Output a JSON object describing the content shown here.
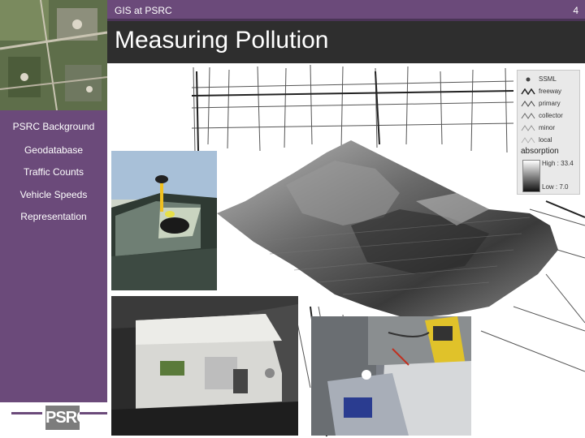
{
  "header": {
    "top_title": "GIS at PSRC",
    "page_number": "4",
    "slide_title": "Measuring Pollution"
  },
  "sidebar": {
    "items": [
      {
        "label": "PSRC Background"
      },
      {
        "label": "Geodatabase"
      },
      {
        "label": "Traffic Counts"
      },
      {
        "label": "Vehicle Speeds"
      },
      {
        "label": "Representation"
      }
    ],
    "logo_text": "PSRC"
  },
  "legend": {
    "entries": [
      "SSML",
      "freeway",
      "primary",
      "collector",
      "minor",
      "local"
    ],
    "absorption_title": "absorption",
    "high_label": "High : 33.4",
    "low_label": "Low : 7.0"
  },
  "colors": {
    "sidebar": "#6b4a7a",
    "title_bar": "#2e2e2e",
    "text_light": "#ffffff"
  },
  "images": [
    "aerial-photo",
    "terrain-surface-map",
    "gps-antenna-car-photo",
    "pollution-monitor-photo",
    "handheld-device-photo"
  ]
}
